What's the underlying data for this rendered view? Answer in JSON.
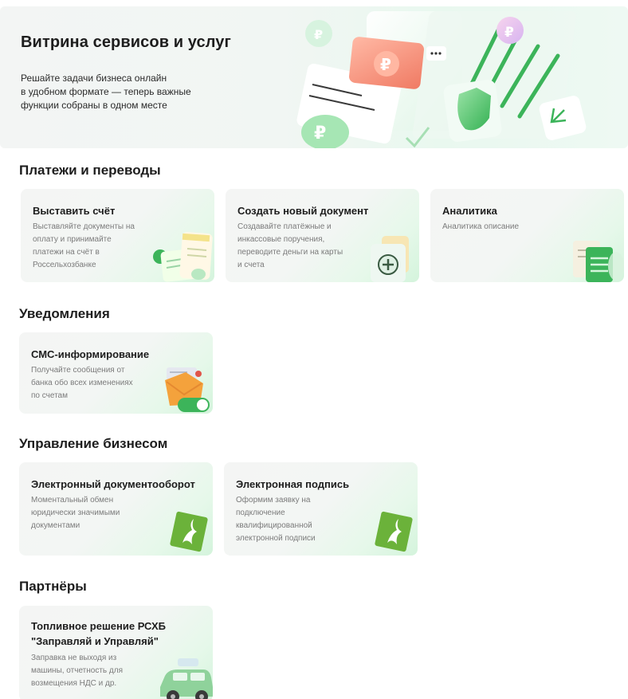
{
  "hero": {
    "title": "Витрина сервисов и услуг",
    "desc_lines": [
      "Решайте задачи бизнеса онлайн",
      "в удобном формате — теперь важные",
      "функции собраны в одном месте"
    ]
  },
  "sections": {
    "payments": {
      "title": "Платежи и переводы",
      "cards": [
        {
          "title": "Выставить счёт",
          "desc_lines": [
            "Выставляйте документы на",
            "оплату и принимайте",
            "платежи на счёт в",
            "Россельхозбанке"
          ]
        },
        {
          "title": "Создать новый документ",
          "desc_lines": [
            "Создавайте платёжные и",
            "инкассовые поручения,",
            "переводите деньги на карты",
            "и счета"
          ]
        },
        {
          "title": "Аналитика",
          "desc_lines": [
            "Аналитика описание"
          ]
        }
      ]
    },
    "notifications": {
      "title": "Уведомления",
      "cards": [
        {
          "title": "СМС-информирование",
          "desc_lines": [
            "Получайте сообщения от",
            "банка обо всех изменениях",
            "по счетам"
          ]
        }
      ]
    },
    "business": {
      "title": "Управление бизнесом",
      "cards": [
        {
          "title": "Электронный документооборот",
          "desc_lines": [
            "Моментальный обмен",
            "юридически значимыми",
            "документами"
          ]
        },
        {
          "title": "Электронная подпись",
          "desc_lines": [
            "Оформим заявку на",
            "подключение",
            "квалифицированной",
            "электронной подписи"
          ]
        }
      ]
    },
    "partners": {
      "title": "Партнёры",
      "cards": [
        {
          "title_lines": [
            "Топливное решение РСХБ",
            "\"Заправляй и Управляй\""
          ],
          "desc_lines": [
            "Заправка не выходя из",
            "машины, отчетность для",
            "возмещения НДС и др."
          ]
        }
      ]
    }
  },
  "colors": {
    "accent": "#3cb45a",
    "accent_light": "#c9f0d3",
    "muted_text": "#7b7b7b",
    "coral": "#f28c72"
  }
}
